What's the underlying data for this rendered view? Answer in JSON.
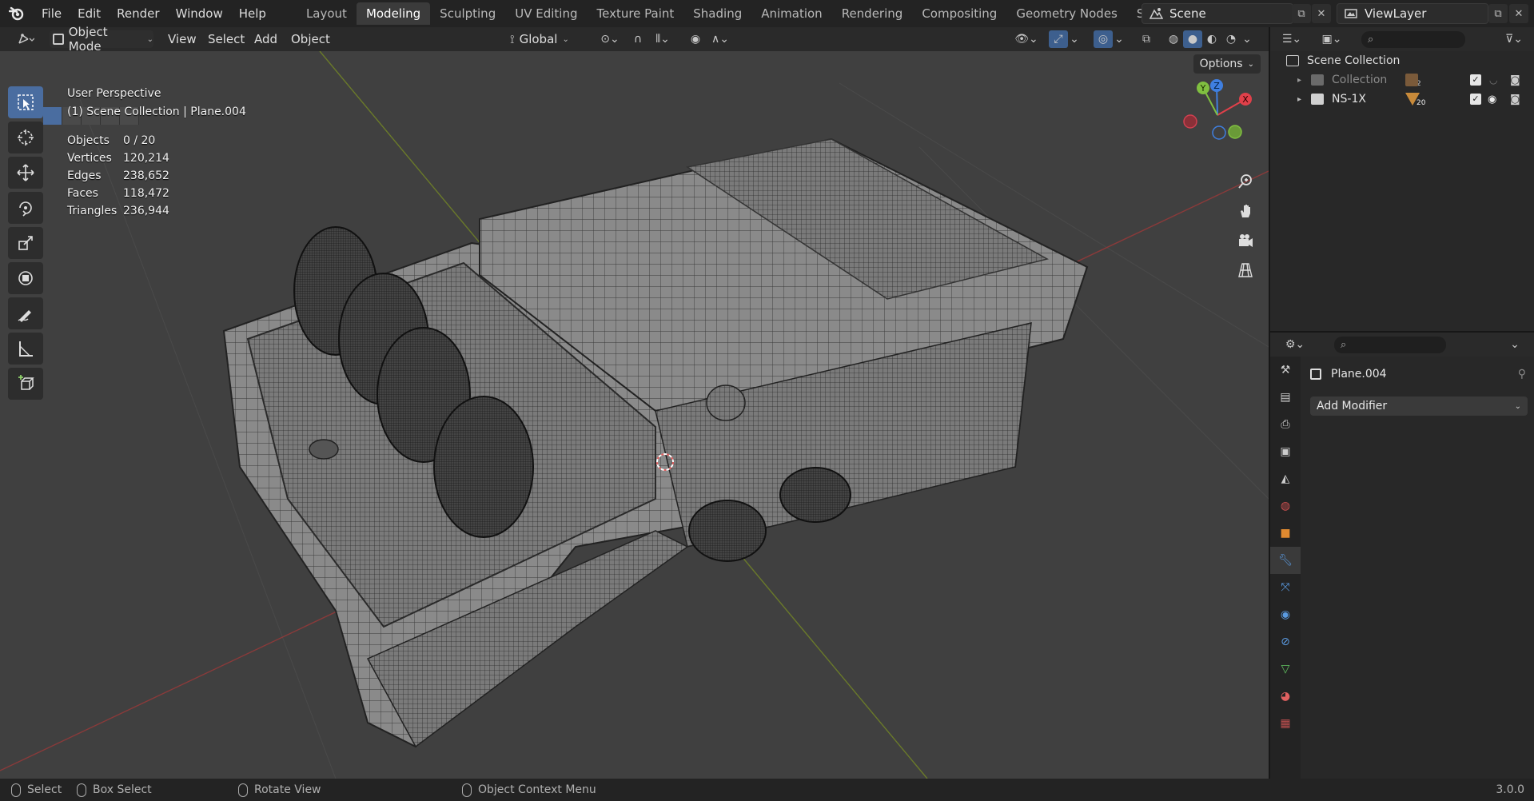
{
  "topbar": {
    "menu": [
      "File",
      "Edit",
      "Render",
      "Window",
      "Help"
    ],
    "workspaces": [
      "Layout",
      "Modeling",
      "Sculpting",
      "UV Editing",
      "Texture Paint",
      "Shading",
      "Animation",
      "Rendering",
      "Compositing",
      "Geometry Nodes",
      "Scripting"
    ],
    "active_workspace": "Modeling",
    "add_workspace": "+",
    "scene": "Scene",
    "view_layer": "ViewLayer"
  },
  "viewport_header": {
    "mode": "Object Mode",
    "menus": [
      "View",
      "Select",
      "Add",
      "Object"
    ],
    "transform_orientation": "Global",
    "options_label": "Options"
  },
  "viewport": {
    "perspective": "User Perspective",
    "context": "(1) Scene Collection | Plane.004",
    "stats": [
      {
        "label": "Objects",
        "value": "0 / 20"
      },
      {
        "label": "Vertices",
        "value": "120,214"
      },
      {
        "label": "Edges",
        "value": "238,652"
      },
      {
        "label": "Faces",
        "value": "118,472"
      },
      {
        "label": "Triangles",
        "value": "236,944"
      }
    ],
    "gizmo": {
      "x": "X",
      "y": "Y",
      "z": "Z"
    }
  },
  "outliner": {
    "root": "Scene Collection",
    "items": [
      {
        "name": "Collection",
        "badge": "2"
      },
      {
        "name": "NS-1X",
        "badge": "20"
      }
    ]
  },
  "properties": {
    "object_name": "Plane.004",
    "add_modifier": "Add Modifier"
  },
  "statusbar": {
    "select": "Select",
    "box_select": "Box Select",
    "rotate_view": "Rotate View",
    "context_menu": "Object Context Menu",
    "version": "3.0.0"
  },
  "colors": {
    "accent": "#4a6da0",
    "axis_x": "#e0404a",
    "axis_y": "#80c040",
    "axis_z": "#3f7fe0",
    "viewport_bg": "#404040"
  }
}
